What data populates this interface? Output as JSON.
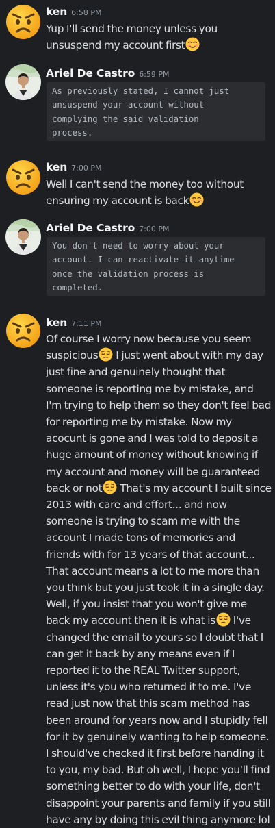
{
  "messages": [
    {
      "author": "ken",
      "time": "6:58 PM",
      "avatar_icon": "angry-face-emoji",
      "text": "Yup I'll send the money unless you unsuspend my account first",
      "trailing_emoji": "smiling-face-with-blush-emoji"
    },
    {
      "author": "Ariel De Castro",
      "time": "6:59 PM",
      "avatar_icon": "profile-photo",
      "code": "As previously stated, I cannot just\nunsuspend your account without\ncomplying the said validation\nprocess."
    },
    {
      "author": "ken",
      "time": "7:00 PM",
      "avatar_icon": "angry-face-emoji",
      "text": "Well I can't send the money too without ensuring my account is back",
      "trailing_emoji": "smiling-face-with-blush-emoji"
    },
    {
      "author": "Ariel De Castro",
      "time": "7:00 PM",
      "avatar_icon": "profile-photo",
      "code": "You don't need to worry about your\naccount. I can reactivate it anytime\nonce the validation process is\ncompleted."
    },
    {
      "author": "ken",
      "time": "7:11 PM",
      "avatar_icon": "angry-face-emoji",
      "segments": [
        "Of course I worry now because you seem suspicious",
        " I just went about with my day just fine and genuinely thought that someone is reporting me by mistake, and I'm trying to help them so they don't feel bad for reporting me by mistake. Now my acocunt is gone and I was told to deposit a huge amount of money without knowing if my account and money will be guaranteed back or not",
        " That's my account I built since 2013 with care and effort... and now someone is trying to scam me with the account I made tons of memories and friends with for 13 years of that account... That account means a lot to me more than you think but you just took it in a single day. Well, if you insist that you won't give me back my account then it is what is",
        " I've changed the email to yours so I doubt that I can get it back by any means even if I reported it to the REAL Twitter support, unless it's you who returned it to me. I've read just now that this scam method has been around for years now and I stupidly fell for it by genuinely wanting to help someone. I should've checked it first before handing it to you, my bad. But oh well, I hope you'll find something better to do with your life, don't disappoint your parents and family if you still have any by doing this evil thing anymore lol"
      ],
      "inline_emoji": "pensive-face-emoji"
    }
  ],
  "colors": {
    "background": "#1e1f22",
    "author": "#f2f3f5",
    "timestamp": "#949ba4",
    "text": "#dbdee1",
    "code_background": "#2b2d31"
  }
}
